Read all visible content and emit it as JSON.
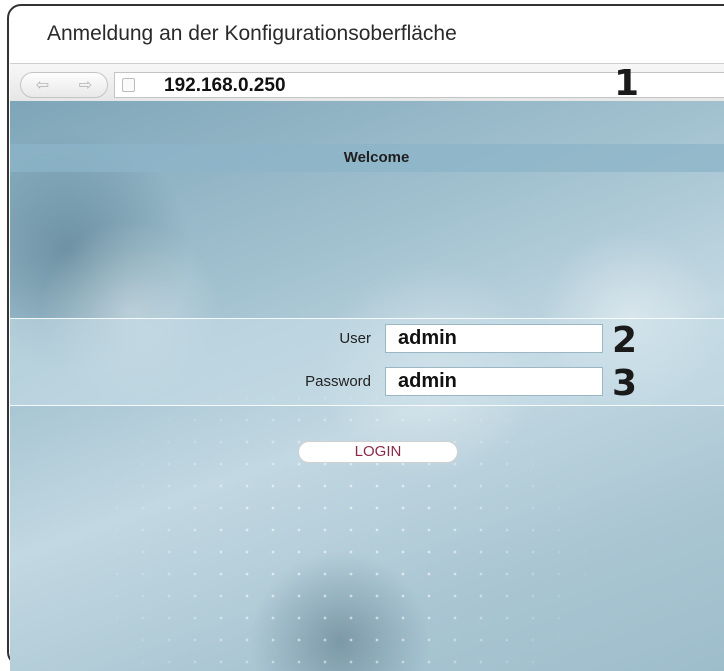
{
  "window": {
    "title": "Anmeldung an der Konfigurationsoberfläche"
  },
  "browser": {
    "back_icon": "back-arrow-icon",
    "forward_icon": "forward-arrow-icon",
    "page_icon": "page-icon",
    "url": "192.168.0.250"
  },
  "page": {
    "welcome": "Welcome",
    "user_label": "User",
    "user_value": "admin",
    "password_label": "Password",
    "password_value": "admin",
    "login_label": "LOGIN"
  },
  "callouts": {
    "c1": "1",
    "c2": "2",
    "c3": "3"
  },
  "colors": {
    "login_text": "#8a2a4a",
    "background": "#a6c4d2",
    "welcome_bar": "#8cb4c8"
  }
}
